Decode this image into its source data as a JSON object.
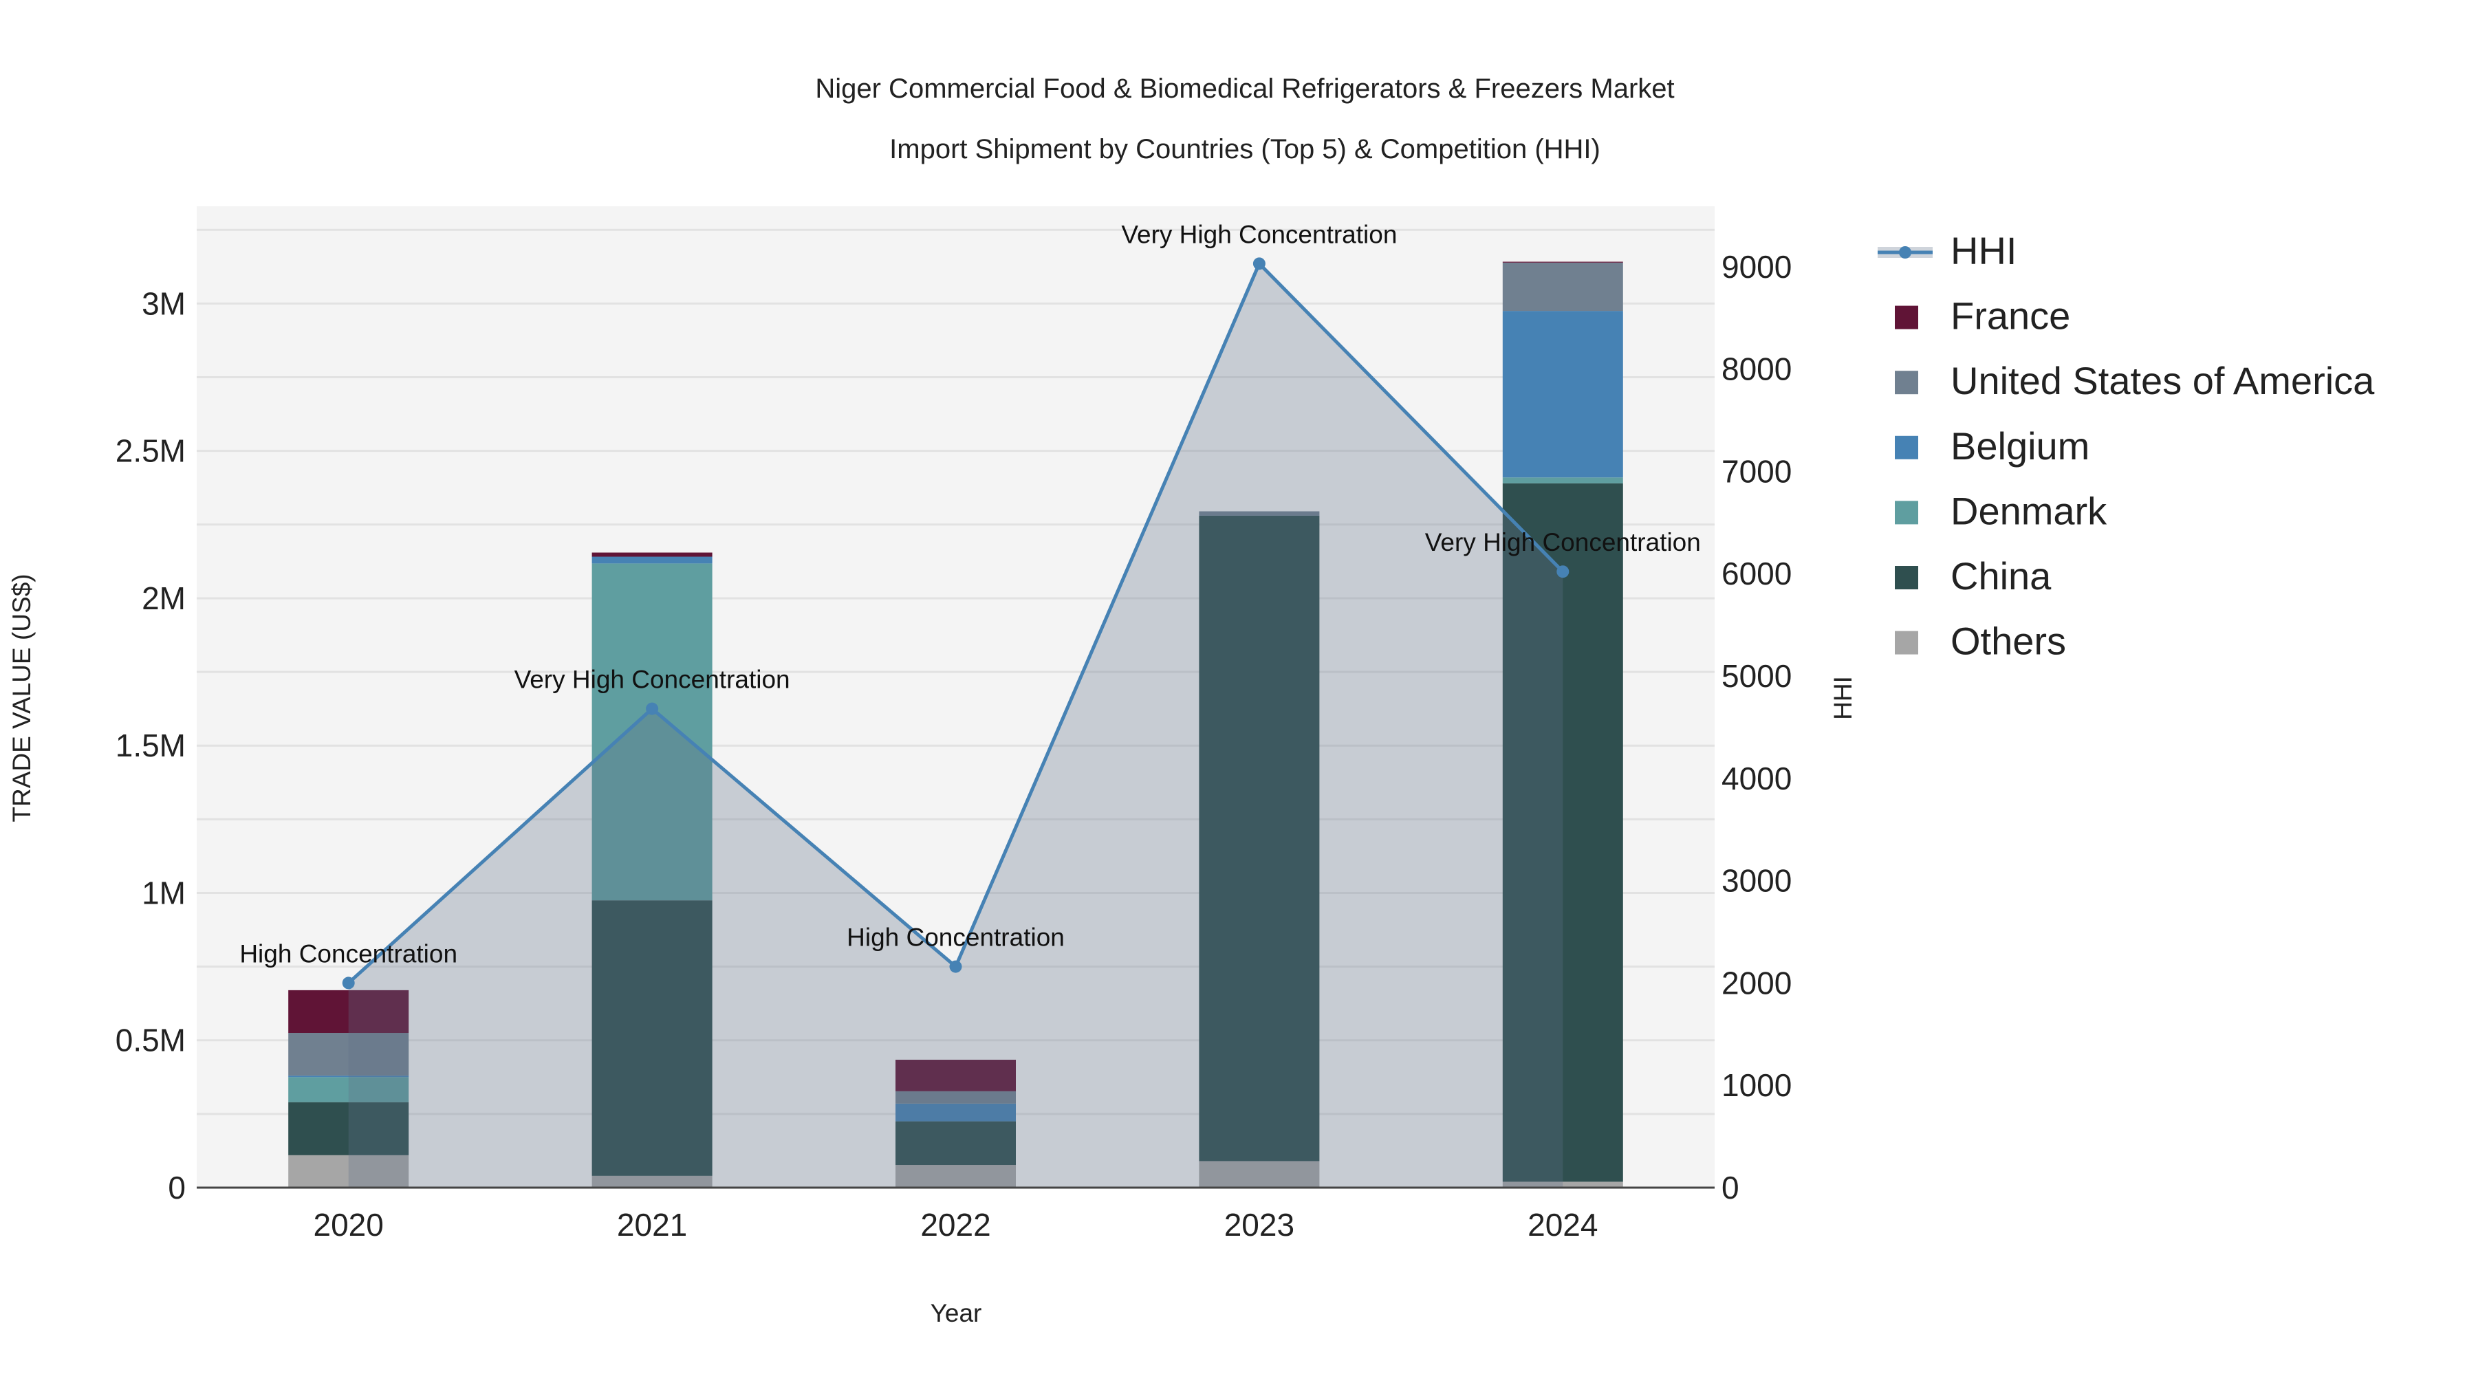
{
  "chart_data": {
    "type": "bar",
    "title_line1": "Niger Commercial Food & Biomedical Refrigerators & Freezers Market",
    "title_line2": "Import Shipment by Countries (Top 5) & Competition (HHI)",
    "xlabel": "Year",
    "ylabel": "TRADE VALUE (US$)",
    "y2label": "HHI",
    "categories": [
      "2020",
      "2021",
      "2022",
      "2023",
      "2024"
    ],
    "ylim": [
      0,
      3330000
    ],
    "y2lim": [
      0,
      9590
    ],
    "yticks": [
      {
        "v": 0,
        "label": "0"
      },
      {
        "v": 500000,
        "label": "0.5M"
      },
      {
        "v": 1000000,
        "label": "1M"
      },
      {
        "v": 1500000,
        "label": "1.5M"
      },
      {
        "v": 2000000,
        "label": "2M"
      },
      {
        "v": 2500000,
        "label": "2.5M"
      },
      {
        "v": 3000000,
        "label": "3M"
      }
    ],
    "y2ticks": [
      {
        "v": 0,
        "label": "0"
      },
      {
        "v": 1000,
        "label": "1000"
      },
      {
        "v": 2000,
        "label": "2000"
      },
      {
        "v": 3000,
        "label": "3000"
      },
      {
        "v": 4000,
        "label": "4000"
      },
      {
        "v": 5000,
        "label": "5000"
      },
      {
        "v": 6000,
        "label": "6000"
      },
      {
        "v": 7000,
        "label": "7000"
      },
      {
        "v": 8000,
        "label": "8000"
      },
      {
        "v": 9000,
        "label": "9000"
      }
    ],
    "series": [
      {
        "name": "Others",
        "color": "#a6a6a6",
        "values": [
          110000,
          40000,
          77000,
          90000,
          20000
        ]
      },
      {
        "name": "China",
        "color": "#2f4f4f",
        "values": [
          180000,
          935000,
          148000,
          2190000,
          2370000
        ]
      },
      {
        "name": "Denmark",
        "color": "#5f9ea0",
        "values": [
          85000,
          1143000,
          0,
          0,
          20000
        ]
      },
      {
        "name": "Belgium",
        "color": "#4682b4",
        "values": [
          5000,
          23000,
          60000,
          0,
          565000
        ]
      },
      {
        "name": "United States of America",
        "color": "#708090",
        "values": [
          145000,
          0,
          42000,
          15000,
          164000
        ]
      },
      {
        "name": "France",
        "color": "#601436",
        "values": [
          145000,
          14000,
          107000,
          0,
          3000
        ]
      }
    ],
    "hhi": {
      "name": "HHI",
      "color": "#4682b4",
      "values": [
        2000,
        4680,
        2160,
        9030,
        6020
      ],
      "annotations": [
        "High Concentration",
        "Very High Concentration",
        "High Concentration",
        "Very High Concentration",
        "Very High Concentration"
      ]
    },
    "legend": [
      "HHI",
      "France",
      "United States of America",
      "Belgium",
      "Denmark",
      "China",
      "Others"
    ],
    "legend_position": "right",
    "grid": true
  }
}
